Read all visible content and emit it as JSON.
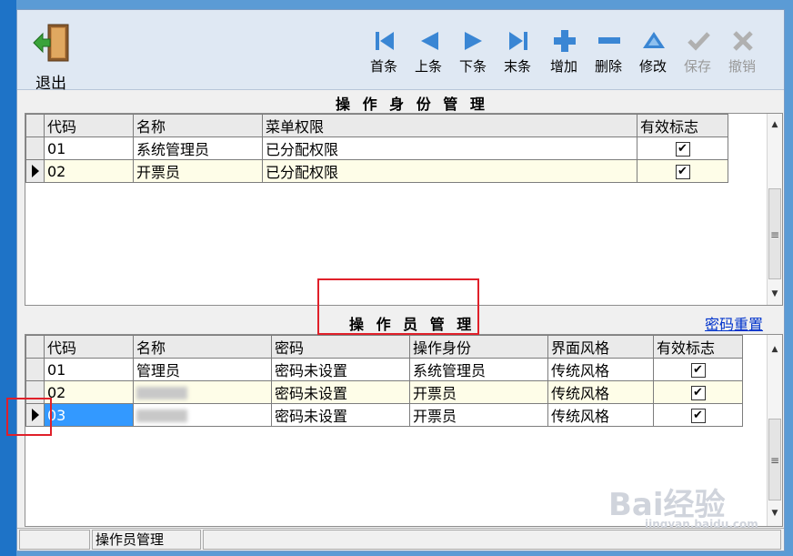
{
  "toolbar": {
    "exit": "退出",
    "first": "首条",
    "prev": "上条",
    "next": "下条",
    "last": "末条",
    "add": "增加",
    "delete": "删除",
    "edit": "修改",
    "save": "保存",
    "undo": "撤销"
  },
  "roles": {
    "title": "操 作 身 份 管 理",
    "columns": [
      "代码",
      "名称",
      "菜单权限",
      "有效标志"
    ],
    "rows": [
      {
        "code": "01",
        "name": "系统管理员",
        "perm": "已分配权限",
        "valid": "✔"
      },
      {
        "code": "02",
        "name": "开票员",
        "perm": "已分配权限",
        "valid": "✔"
      }
    ]
  },
  "operators": {
    "title": "操 作 员 管 理",
    "reset_link": "密码重置",
    "columns": [
      "代码",
      "名称",
      "密码",
      "操作身份",
      "界面风格",
      "有效标志"
    ],
    "rows": [
      {
        "code": "01",
        "name": "管理员",
        "pwd": "密码未设置",
        "role": "系统管理员",
        "style": "传统风格",
        "valid": "✔"
      },
      {
        "code": "02",
        "name": "",
        "pwd": "密码未设置",
        "role": "开票员",
        "style": "传统风格",
        "valid": "✔"
      },
      {
        "code": "03",
        "name": "",
        "pwd": "密码未设置",
        "role": "开票员",
        "style": "传统风格",
        "valid": "✔"
      }
    ]
  },
  "status": {
    "tab": "操作员管理"
  },
  "watermark": {
    "brand": "Bai经验",
    "url": "jingyan.baidu.com"
  },
  "colors": {
    "accent": "#1e73c7",
    "highlight": "#e0202a",
    "selected": "#3399ff"
  }
}
